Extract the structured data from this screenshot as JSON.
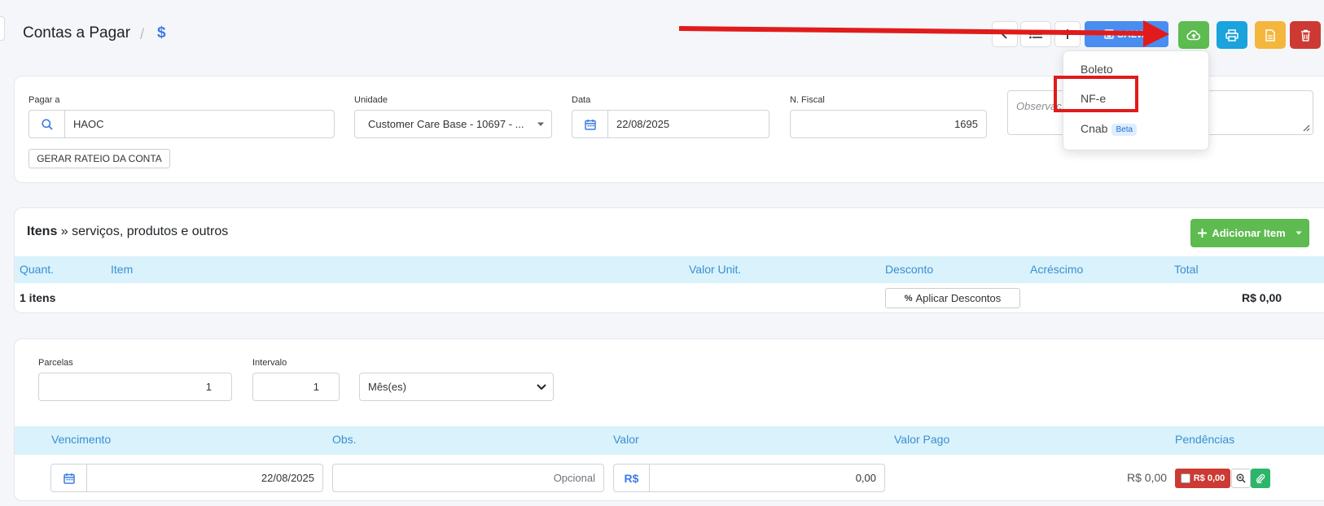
{
  "header": {
    "title": "Contas a Pagar",
    "separator": "/",
    "crumb_icon": "$",
    "save_label": "SALVA"
  },
  "form": {
    "pagar_a": {
      "label": "Pagar a",
      "value": "HAOC"
    },
    "unidade": {
      "label": "Unidade",
      "value": "Customer Care Base - 10697 - ..."
    },
    "data": {
      "label": "Data",
      "value": "22/08/2025"
    },
    "n_fiscal": {
      "label": "N. Fiscal",
      "value": "1695"
    },
    "observacao": {
      "placeholder": "Observaç"
    },
    "rateio_button": "GERAR RATEIO DA CONTA"
  },
  "dropdown": {
    "items": [
      {
        "label": "Boleto"
      },
      {
        "label": "NF-e"
      },
      {
        "label": "Cnab",
        "badge": "Beta"
      }
    ]
  },
  "items_section": {
    "title_bold": "Itens",
    "title_rest": " » serviços, produtos e outros",
    "add_button": "Adicionar Item",
    "columns": [
      "Quant.",
      "Item",
      "Valor Unit.",
      "Desconto",
      "Acréscimo",
      "Total"
    ],
    "summary_count": "1 itens",
    "apply_discount": "Aplicar Descontos",
    "total": "R$ 0,00"
  },
  "parcelas_section": {
    "parcelas": {
      "label": "Parcelas",
      "value": "1"
    },
    "intervalo": {
      "label": "Intervalo",
      "value": "1"
    },
    "periodo": {
      "value": "Mês(es)"
    },
    "columns": [
      "Vencimento",
      "Obs.",
      "Valor",
      "Valor Pago",
      "Pendências"
    ],
    "row": {
      "vencimento": "22/08/2025",
      "obs_placeholder": "Opcional",
      "currency": "R$",
      "valor": "0,00",
      "valor_pago": "R$ 0,00",
      "pendencia_badge": "R$ 0,00"
    }
  },
  "colors": {
    "primary": "#4a8df0",
    "green": "#5dbb4f",
    "teal": "#1aa3dc",
    "yellow": "#f4b63d",
    "red": "#cc3a33",
    "annotation": "#e11b1b"
  }
}
